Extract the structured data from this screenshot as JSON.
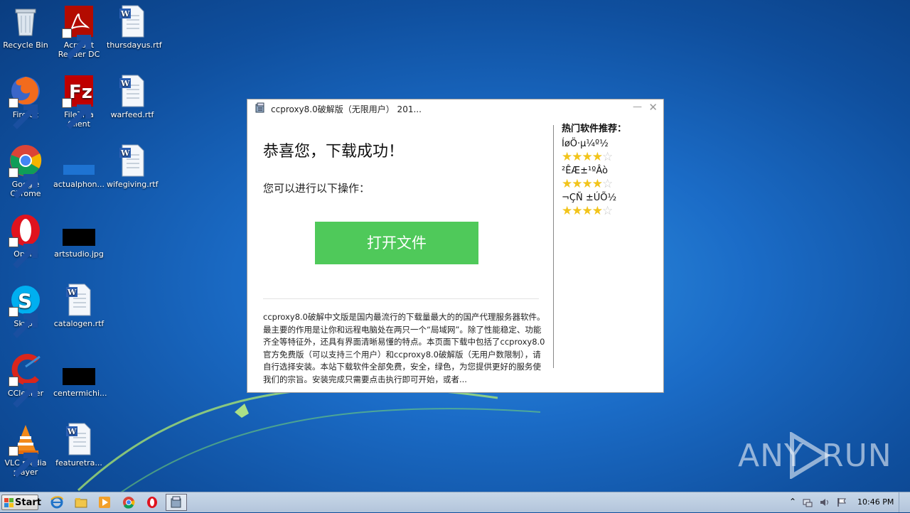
{
  "desktop": {
    "icons": [
      {
        "label": "Recycle Bin",
        "icon": "recycle-bin-icon"
      },
      {
        "label": "Acrobat Reader DC",
        "icon": "acrobat-icon"
      },
      {
        "label": "thursdayus.rtf",
        "icon": "word-doc-icon"
      },
      {
        "label": "Firefox",
        "icon": "firefox-icon"
      },
      {
        "label": "FileZilla Client",
        "icon": "filezilla-icon"
      },
      {
        "label": "warfeed.rtf",
        "icon": "word-doc-icon"
      },
      {
        "label": "Google Chrome",
        "icon": "chrome-icon"
      },
      {
        "label": "actualphon...",
        "icon": "blank-file-icon"
      },
      {
        "label": "wifegiving.rtf",
        "icon": "word-doc-icon"
      },
      {
        "label": "Opera",
        "icon": "opera-icon"
      },
      {
        "label": "artstudio.jpg",
        "icon": "image-thumbnail-icon"
      },
      {
        "label": "Skype",
        "icon": "skype-icon"
      },
      {
        "label": "catalogen.rtf",
        "icon": "word-doc-icon"
      },
      {
        "label": "CCleaner",
        "icon": "ccleaner-icon"
      },
      {
        "label": "centermichi...",
        "icon": "image-thumbnail-icon"
      },
      {
        "label": "VLC media player",
        "icon": "vlc-icon"
      },
      {
        "label": "featuretra...",
        "icon": "word-doc-icon"
      }
    ]
  },
  "dialog": {
    "title": "ccproxy8.0破解版（无限用户） 201...",
    "heading": "恭喜您，下载成功！",
    "subheading": "您可以进行以下操作：",
    "open_button": "打开文件",
    "description": "ccproxy8.0破解中文版是国内最流行的下载量最大的的国产代理服务器软件。最主要的作用是让你和远程电脑处在两只一个“局域网”。除了性能稳定、功能齐全等特征外，还具有界面清晰易懂的特点。本页面下载中包括了ccproxy8.0官方免费版（可以支持三个用户）和ccproxy8.0破解版（无用户数限制），请自行选择安装。本站下载软件全部免费，安全，绿色，为您提供更好的服务使我们的宗旨。安装完成只需要点击执行即可开始，或者...",
    "sidebar_title": "热门软件推荐：",
    "recommendations": [
      {
        "name": "ÍøÖ·µ¼º½",
        "rating": 4,
        "max": 5
      },
      {
        "name": "²ÊÆ±¹ºÂò",
        "rating": 4,
        "max": 5
      },
      {
        "name": "¬ÇÑ ±ÚÕ½",
        "rating": 4,
        "max": 5
      }
    ]
  },
  "watermark": {
    "left": "ANY",
    "right": "RUN"
  },
  "taskbar": {
    "start_label": "Start",
    "pinned": [
      "ie-icon",
      "explorer-icon",
      "media-player-icon",
      "chrome-icon",
      "opera-icon",
      "installer-icon"
    ],
    "clock": "10:46 PM"
  },
  "colors": {
    "accent_button": "#4fc95a",
    "star": "#f2c41b"
  }
}
